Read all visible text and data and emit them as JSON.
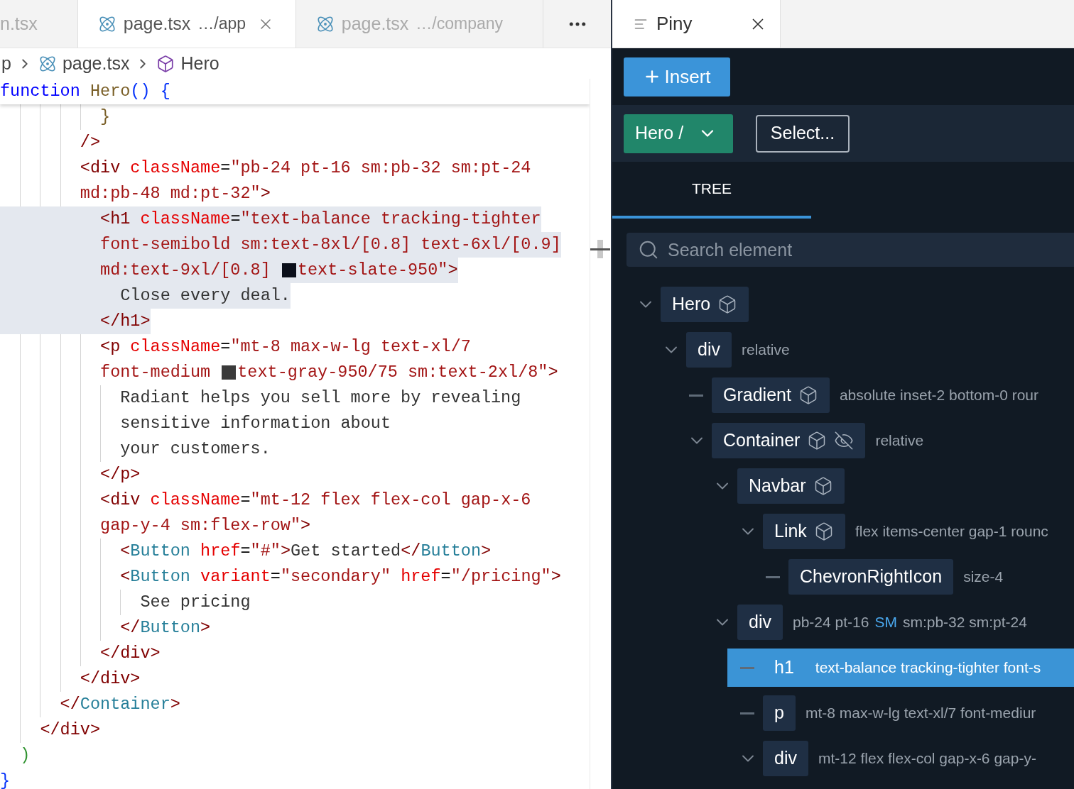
{
  "editor_tabs": [
    {
      "label": "n.tsx",
      "selected": false,
      "icon": false
    },
    {
      "label": "page.tsx",
      "path": "…/app",
      "selected": true,
      "icon": true
    },
    {
      "label": "page.tsx",
      "path": "…/company",
      "selected": false,
      "icon": true
    }
  ],
  "panel_tab": {
    "label": "Piny"
  },
  "breadcrumb": [
    {
      "kind": "folder",
      "label": "p"
    },
    {
      "kind": "file",
      "label": "page.tsx"
    },
    {
      "kind": "component",
      "label": "Hero"
    }
  ],
  "code_lines": [
    {
      "highlighted": false,
      "sticky": true,
      "tokens": [
        {
          "kind": "keyword",
          "text": "function"
        },
        {
          "kind": "function",
          "text": " Hero"
        },
        {
          "kind": "bracket",
          "text": "()"
        },
        {
          "kind": "bracket",
          "text": " {"
        }
      ]
    },
    {
      "highlighted": false,
      "tokens": [
        {
          "kind": "function",
          "text": "          }"
        }
      ]
    },
    {
      "highlighted": false,
      "tokens": [
        {
          "kind": "tag",
          "text": "        />"
        }
      ]
    },
    {
      "highlighted": false,
      "tokens": [
        {
          "kind": "tag",
          "text": "        <div"
        },
        {
          "kind": "attr",
          "text": " className"
        },
        {
          "kind": "plain",
          "text": "="
        },
        {
          "kind": "string",
          "text": "\"pb-24 pt-16 sm:pb-32 sm:pt-24"
        }
      ]
    },
    {
      "highlighted": false,
      "tokens": [
        {
          "kind": "string",
          "text": "        md:pb-48 md:pt-32\""
        },
        {
          "kind": "tag",
          "text": ">"
        }
      ]
    },
    {
      "highlighted": true,
      "tokens": [
        {
          "kind": "tag",
          "text": "          <h1"
        },
        {
          "kind": "attr",
          "text": " className"
        },
        {
          "kind": "plain",
          "text": "="
        },
        {
          "kind": "string",
          "text": "\"text-balance tracking-tighter"
        }
      ]
    },
    {
      "highlighted": true,
      "tokens": [
        {
          "kind": "string",
          "text": "          font-semibold sm:text-8xl/[0.8] text-6xl/[0.9]"
        }
      ]
    },
    {
      "highlighted": true,
      "tokens": [
        {
          "kind": "string",
          "text": "          md:text-9xl/[0.8] "
        },
        {
          "kind": "swatch",
          "color": "#0b0f1a"
        },
        {
          "kind": "string",
          "text": "text-slate-950\""
        },
        {
          "kind": "tag",
          "text": ">"
        }
      ]
    },
    {
      "highlighted": true,
      "tokens": [
        {
          "kind": "text",
          "text": "            Close every deal."
        }
      ]
    },
    {
      "highlighted": true,
      "tokens": [
        {
          "kind": "tag",
          "text": "          </h1>"
        }
      ]
    },
    {
      "highlighted": false,
      "tokens": [
        {
          "kind": "tag",
          "text": "          <p"
        },
        {
          "kind": "attr",
          "text": " className"
        },
        {
          "kind": "plain",
          "text": "="
        },
        {
          "kind": "string",
          "text": "\"mt-8 max-w-lg text-xl/7"
        }
      ]
    },
    {
      "highlighted": false,
      "tokens": [
        {
          "kind": "string",
          "text": "          font-medium "
        },
        {
          "kind": "swatch",
          "color": "#3a3a3a"
        },
        {
          "kind": "string",
          "text": "text-gray-950/75 sm:text-2xl/8\""
        },
        {
          "kind": "tag",
          "text": ">"
        }
      ]
    },
    {
      "highlighted": false,
      "tokens": [
        {
          "kind": "text",
          "text": "            Radiant helps you sell more by revealing"
        }
      ]
    },
    {
      "highlighted": false,
      "tokens": [
        {
          "kind": "text",
          "text": "            sensitive information about"
        }
      ]
    },
    {
      "highlighted": false,
      "tokens": [
        {
          "kind": "text",
          "text": "            your customers."
        }
      ]
    },
    {
      "highlighted": false,
      "tokens": [
        {
          "kind": "tag",
          "text": "          </p>"
        }
      ]
    },
    {
      "highlighted": false,
      "tokens": [
        {
          "kind": "tag",
          "text": "          <div"
        },
        {
          "kind": "attr",
          "text": " className"
        },
        {
          "kind": "plain",
          "text": "="
        },
        {
          "kind": "string",
          "text": "\"mt-12 flex flex-col gap-x-6"
        }
      ]
    },
    {
      "highlighted": false,
      "tokens": [
        {
          "kind": "string",
          "text": "          gap-y-4 sm:flex-row\""
        },
        {
          "kind": "tag",
          "text": ">"
        }
      ]
    },
    {
      "highlighted": false,
      "tokens": [
        {
          "kind": "tag",
          "text": "            <"
        },
        {
          "kind": "component",
          "text": "Button"
        },
        {
          "kind": "attr",
          "text": " href"
        },
        {
          "kind": "plain",
          "text": "="
        },
        {
          "kind": "string",
          "text": "\"#\""
        },
        {
          "kind": "tag",
          "text": ">"
        },
        {
          "kind": "text",
          "text": "Get started"
        },
        {
          "kind": "tag",
          "text": "</"
        },
        {
          "kind": "component",
          "text": "Button"
        },
        {
          "kind": "tag",
          "text": ">"
        }
      ]
    },
    {
      "highlighted": false,
      "tokens": [
        {
          "kind": "tag",
          "text": "            <"
        },
        {
          "kind": "component",
          "text": "Button"
        },
        {
          "kind": "attr",
          "text": " variant"
        },
        {
          "kind": "plain",
          "text": "="
        },
        {
          "kind": "string",
          "text": "\"secondary\""
        },
        {
          "kind": "attr",
          "text": " href"
        },
        {
          "kind": "plain",
          "text": "="
        },
        {
          "kind": "string",
          "text": "\"/pricing\""
        },
        {
          "kind": "tag",
          "text": ">"
        }
      ]
    },
    {
      "highlighted": false,
      "tokens": [
        {
          "kind": "text",
          "text": "              See pricing"
        }
      ]
    },
    {
      "highlighted": false,
      "tokens": [
        {
          "kind": "tag",
          "text": "            </"
        },
        {
          "kind": "component",
          "text": "Button"
        },
        {
          "kind": "tag",
          "text": ">"
        }
      ]
    },
    {
      "highlighted": false,
      "tokens": [
        {
          "kind": "tag",
          "text": "          </div>"
        }
      ]
    },
    {
      "highlighted": false,
      "tokens": [
        {
          "kind": "tag",
          "text": "        </div>"
        }
      ]
    },
    {
      "highlighted": false,
      "tokens": [
        {
          "kind": "tag",
          "text": "      </"
        },
        {
          "kind": "component",
          "text": "Container"
        },
        {
          "kind": "tag",
          "text": ">"
        }
      ]
    },
    {
      "highlighted": false,
      "tokens": [
        {
          "kind": "tag",
          "text": "    </div>"
        }
      ]
    },
    {
      "highlighted": false,
      "tokens": [
        {
          "kind": "paren",
          "text": "  )"
        }
      ]
    },
    {
      "highlighted": false,
      "tokens": [
        {
          "kind": "bracket",
          "text": "}"
        }
      ]
    }
  ],
  "toolbar": {
    "insert_button": "Insert",
    "component_button": "Hero /",
    "select_button": "Select..."
  },
  "panel_tabs": [
    {
      "label": "TREE",
      "selected": true
    }
  ],
  "search": {
    "placeholder": "Search element"
  },
  "tree": [
    {
      "label": "Hero",
      "component": true,
      "hidden": false,
      "expanded": true,
      "selected": false,
      "children": [
        {
          "label": "div",
          "component": false,
          "hidden": false,
          "expanded": true,
          "selected": false,
          "classes": [
            {
              "kind": "plain",
              "text": "relative"
            }
          ],
          "children": [
            {
              "label": "Gradient",
              "component": true,
              "hidden": false,
              "selected": false,
              "classes": [
                {
                  "kind": "plain",
                  "text": "absolute inset-2 bottom-0 rour"
                }
              ]
            },
            {
              "label": "Container",
              "component": true,
              "hidden": true,
              "expanded": true,
              "selected": false,
              "classes": [
                {
                  "kind": "plain",
                  "text": "relative"
                }
              ],
              "children": [
                {
                  "label": "Navbar",
                  "component": true,
                  "hidden": false,
                  "expanded": true,
                  "selected": false,
                  "children": [
                    {
                      "label": "Link",
                      "component": true,
                      "hidden": false,
                      "expanded": true,
                      "selected": false,
                      "classes": [
                        {
                          "kind": "plain",
                          "text": "flex items-center gap-1 rounc"
                        }
                      ],
                      "children": [
                        {
                          "label": "ChevronRightIcon",
                          "component": false,
                          "hidden": false,
                          "selected": false,
                          "classes": [
                            {
                              "kind": "plain",
                              "text": "size-4"
                            }
                          ]
                        }
                      ]
                    }
                  ]
                },
                {
                  "label": "div",
                  "component": false,
                  "hidden": false,
                  "expanded": true,
                  "selected": false,
                  "classes": [
                    {
                      "kind": "plain",
                      "text": "pb-24 pt-16"
                    },
                    {
                      "kind": "breakpoint",
                      "text": "SM"
                    },
                    {
                      "kind": "plain",
                      "text": "sm:pb-32 sm:pt-24"
                    }
                  ],
                  "children": [
                    {
                      "label": "h1",
                      "component": false,
                      "hidden": false,
                      "selected": true,
                      "classes": [
                        {
                          "kind": "plain",
                          "text": "text-balance tracking-tighter font-s"
                        }
                      ]
                    },
                    {
                      "label": "p",
                      "component": false,
                      "hidden": false,
                      "selected": false,
                      "classes": [
                        {
                          "kind": "plain",
                          "text": "mt-8 max-w-lg text-xl/7 font-mediur"
                        }
                      ]
                    },
                    {
                      "label": "div",
                      "component": false,
                      "hidden": false,
                      "expanded": true,
                      "selected": false,
                      "classes": [
                        {
                          "kind": "plain",
                          "text": "mt-12 flex flex-col gap-x-6 gap-y-"
                        }
                      ]
                    }
                  ]
                }
              ]
            }
          ]
        }
      ]
    }
  ]
}
